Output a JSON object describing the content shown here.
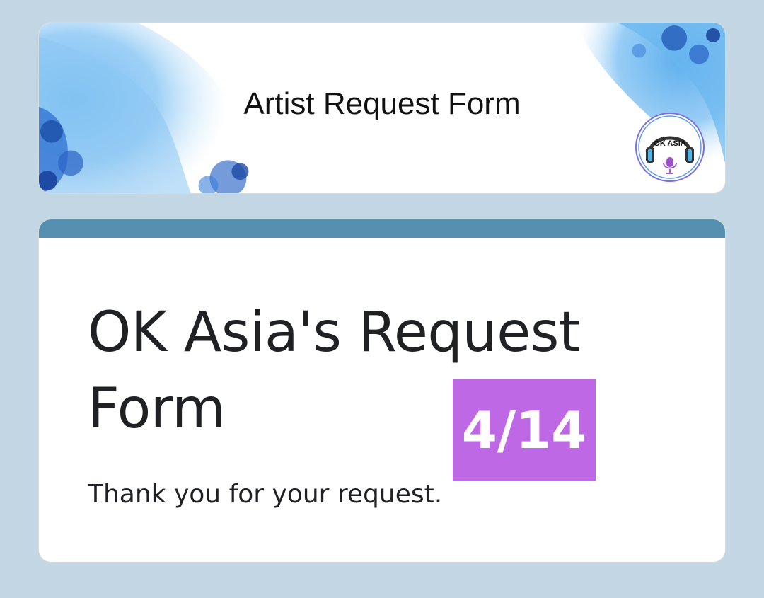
{
  "header": {
    "title": "Artist Request Form",
    "logo_text": "OK ASIA",
    "logo_icon": "headphones-microphone-icon"
  },
  "form": {
    "title": "OK Asia's Request Form",
    "date_badge": "4/14",
    "confirmation_message": "Thank you for your request."
  },
  "colors": {
    "page_background": "#c3d6e4",
    "card_accent": "#5590b0",
    "badge_background": "#bf68e6",
    "watercolor_blue": "#4fa6ea"
  }
}
